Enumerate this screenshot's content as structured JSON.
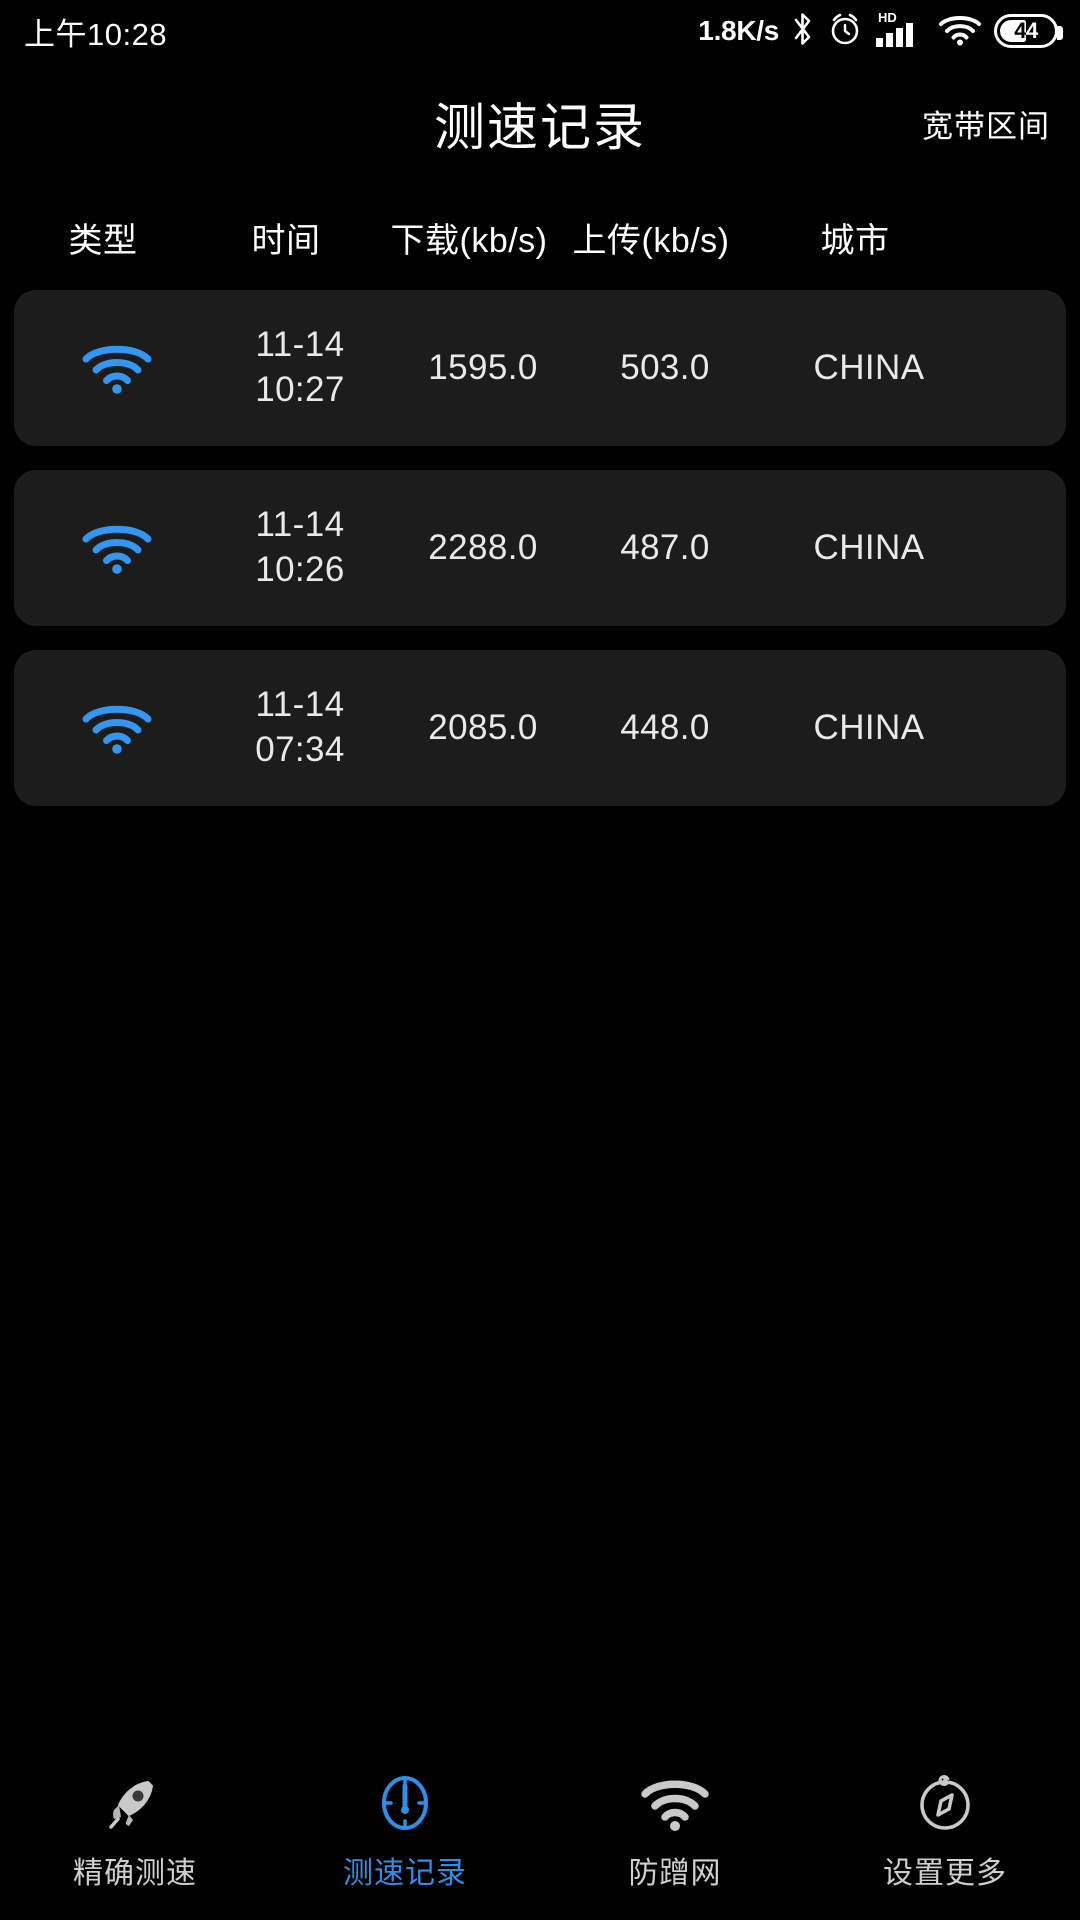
{
  "status_bar": {
    "clock": "上午10:28",
    "net_speed": "1.8K/s",
    "bluetooth_icon": "bluetooth-icon",
    "alarm_icon": "alarm-clock-icon",
    "hd_label": "HD",
    "signal_icon": "cellular-signal-icon",
    "wifi_icon": "wifi-icon",
    "battery_level": "44"
  },
  "app_bar": {
    "title": "测速记录",
    "action_label": "宽带区间"
  },
  "table": {
    "headers": [
      "类型",
      "时间",
      "下载(kb/s)",
      "上传(kb/s)",
      "城市"
    ],
    "rows": [
      {
        "type_icon": "wifi-icon",
        "date": "11-14",
        "time": "10:27",
        "download": "1595.0",
        "upload": "503.0",
        "city": "CHINA"
      },
      {
        "type_icon": "wifi-icon",
        "date": "11-14",
        "time": "10:26",
        "download": "2288.0",
        "upload": "487.0",
        "city": "CHINA"
      },
      {
        "type_icon": "wifi-icon",
        "date": "11-14",
        "time": "07:34",
        "download": "2085.0",
        "upload": "448.0",
        "city": "CHINA"
      }
    ]
  },
  "bottom_nav": {
    "items": [
      {
        "label": "精确测速",
        "icon": "rocket-icon",
        "active": false
      },
      {
        "label": "测速记录",
        "icon": "speedometer-icon",
        "active": true
      },
      {
        "label": "防蹭网",
        "icon": "wifi-icon",
        "active": false
      },
      {
        "label": "设置更多",
        "icon": "compass-icon",
        "active": false
      }
    ]
  },
  "colors": {
    "background": "#000000",
    "card": "#1c1c1c",
    "accent": "#2f8fe8",
    "wifi_row": "#3396f0",
    "text_primary": "#ffffff",
    "text_secondary": "#cfcfcf"
  }
}
